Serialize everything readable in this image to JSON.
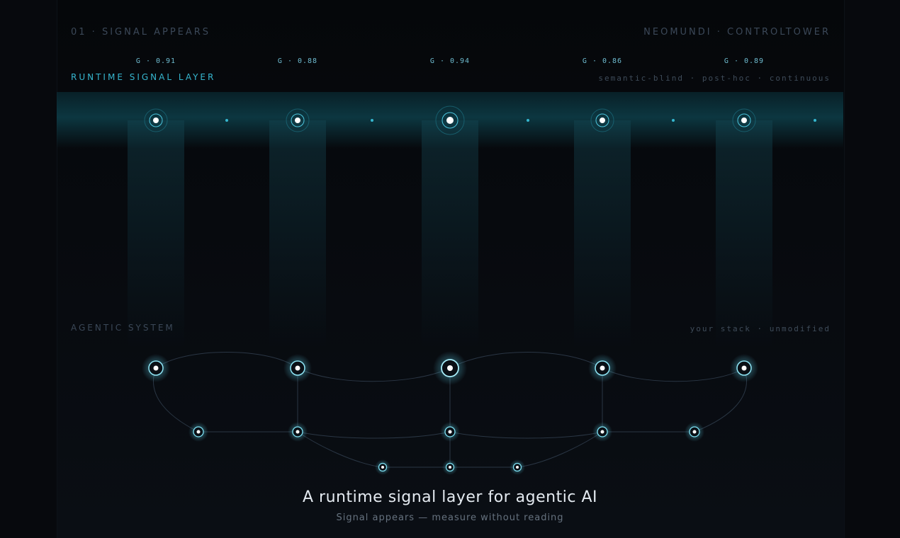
{
  "header": {
    "section": "01 · SIGNAL APPEARS",
    "brand": "NEOMUNDI · CONTROLTOWER"
  },
  "signal_layer": {
    "title": "RUNTIME SIGNAL LAYER",
    "subtitle": "semantic-blind · post-hoc · continuous",
    "g_values": [
      "G · 0.91",
      "G · 0.88",
      "G · 0.94",
      "G · 0.86",
      "G · 0.89"
    ]
  },
  "agentic_system": {
    "title": "AGENTIC SYSTEM",
    "subtitle": "your stack · unmodified"
  },
  "footer": {
    "headline": "A runtime signal layer for agentic AI",
    "tagline": "Signal appears — measure without reading"
  },
  "colors": {
    "accent": "#36b6cf",
    "node_ring": "#7fe3f5",
    "node_core": "#ffffff",
    "edge": "#2a3644"
  }
}
